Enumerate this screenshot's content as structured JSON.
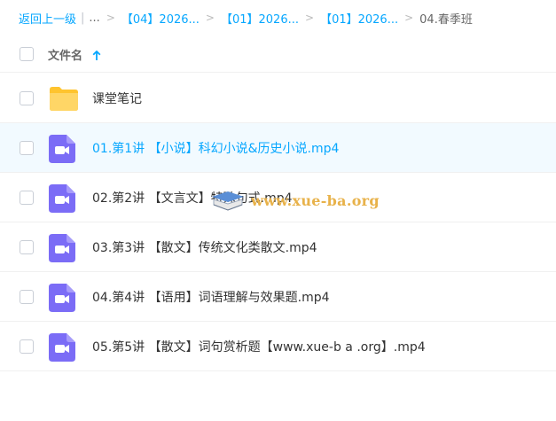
{
  "breadcrumb": {
    "back": "返回上一级",
    "ellipsis": "...",
    "items": [
      "【04】2026...",
      "【01】2026...",
      "【01】2026..."
    ],
    "current": "04.春季班",
    "separator": ">"
  },
  "header": {
    "column_label": "文件名"
  },
  "files": [
    {
      "name": "课堂笔记",
      "type": "folder"
    },
    {
      "name": "01.第1讲 【小说】科幻小说&历史小说.mp4",
      "type": "video"
    },
    {
      "name": "02.第2讲 【文言文】特殊句式.mp4",
      "type": "video"
    },
    {
      "name": "03.第3讲 【散文】传统文化类散文.mp4",
      "type": "video"
    },
    {
      "name": "04.第4讲 【语用】词语理解与效果题.mp4",
      "type": "video"
    },
    {
      "name": "05.第5讲 【散文】词句赏析题【www.xue-b a .org】.mp4",
      "type": "video"
    }
  ],
  "watermark": {
    "text": "www.xue-ba.org"
  },
  "colors": {
    "accent": "#06a7ff",
    "folder": "#ffd04b",
    "video": "#7b6cf6",
    "active_row": "#f2faff"
  }
}
